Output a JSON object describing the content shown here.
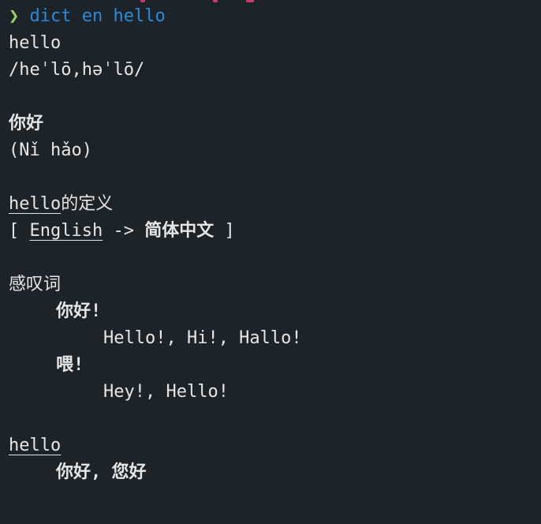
{
  "theme": {
    "background": "#1c2329",
    "foreground": "#e6e6e6",
    "prompt_color": "#9ad45a",
    "command_color": "#2a8bdc"
  },
  "prompt": {
    "symbol": "❯",
    "command": "dict en hello"
  },
  "entry": {
    "word": "hello",
    "phonetic": "/heˈlō,həˈlō/",
    "translation": "你好",
    "pinyin": "(Nǐ hǎo)"
  },
  "definition_header": {
    "word": "hello",
    "suffix": "的定义",
    "bracket_open": "[",
    "source_lang": "English",
    "arrow": "->",
    "target_lang": "简体中文",
    "bracket_close": "]"
  },
  "senses": [
    {
      "part_of_speech": "感叹词",
      "items": [
        {
          "meaning": "你好!",
          "examples": "Hello!, Hi!, Hallo!"
        },
        {
          "meaning": "喂!",
          "examples": "Hey!, Hello!"
        }
      ]
    }
  ],
  "translations": {
    "word": "hello",
    "values": "你好, 您好"
  }
}
